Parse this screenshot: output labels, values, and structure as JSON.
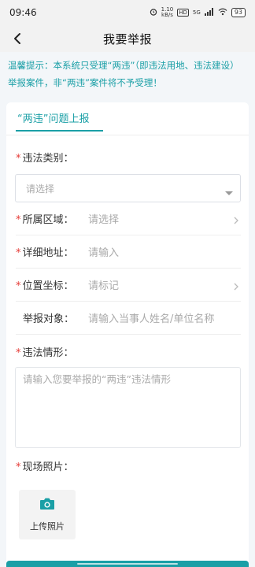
{
  "status_bar": {
    "time": "09:46",
    "network": "5G",
    "speed": "1.10\nkB/s",
    "hd": "HD",
    "battery": "93"
  },
  "nav": {
    "title": "我要举报"
  },
  "notice": {
    "text": "温馨提示：本系统只受理“两违”（即违法用地、违法建设）举报案件，非“两违”案件将不予受理！"
  },
  "tab": {
    "label": "“两违”问题上报"
  },
  "form": {
    "required_mark": "*",
    "violation_type": {
      "label": "违法类别：",
      "placeholder": "请选择"
    },
    "rows": [
      {
        "label": "所属区域：",
        "value": "请选择",
        "required": true,
        "chevron": true
      },
      {
        "label": "详细地址：",
        "value": "请输入",
        "required": true,
        "chevron": false
      },
      {
        "label": "位置坐标：",
        "value": "请标记",
        "required": true,
        "chevron": true
      },
      {
        "label": "举报对象：",
        "value": "请输入当事人姓名/单位名称",
        "required": false,
        "chevron": false
      }
    ],
    "situation": {
      "label": "违法情形：",
      "placeholder": "请输入您要举报的“两违”违法情形"
    },
    "photos": {
      "label": "现场照片：",
      "upload_label": "上传照片"
    }
  },
  "colors": {
    "accent": "#1a9fa6",
    "required": "#e53935",
    "placeholder": "#aaaaaa"
  },
  "icons": {
    "back": "chevron-left-icon",
    "caret": "caret-down-icon",
    "chevron": "chevron-right-icon",
    "camera": "camera-icon"
  }
}
